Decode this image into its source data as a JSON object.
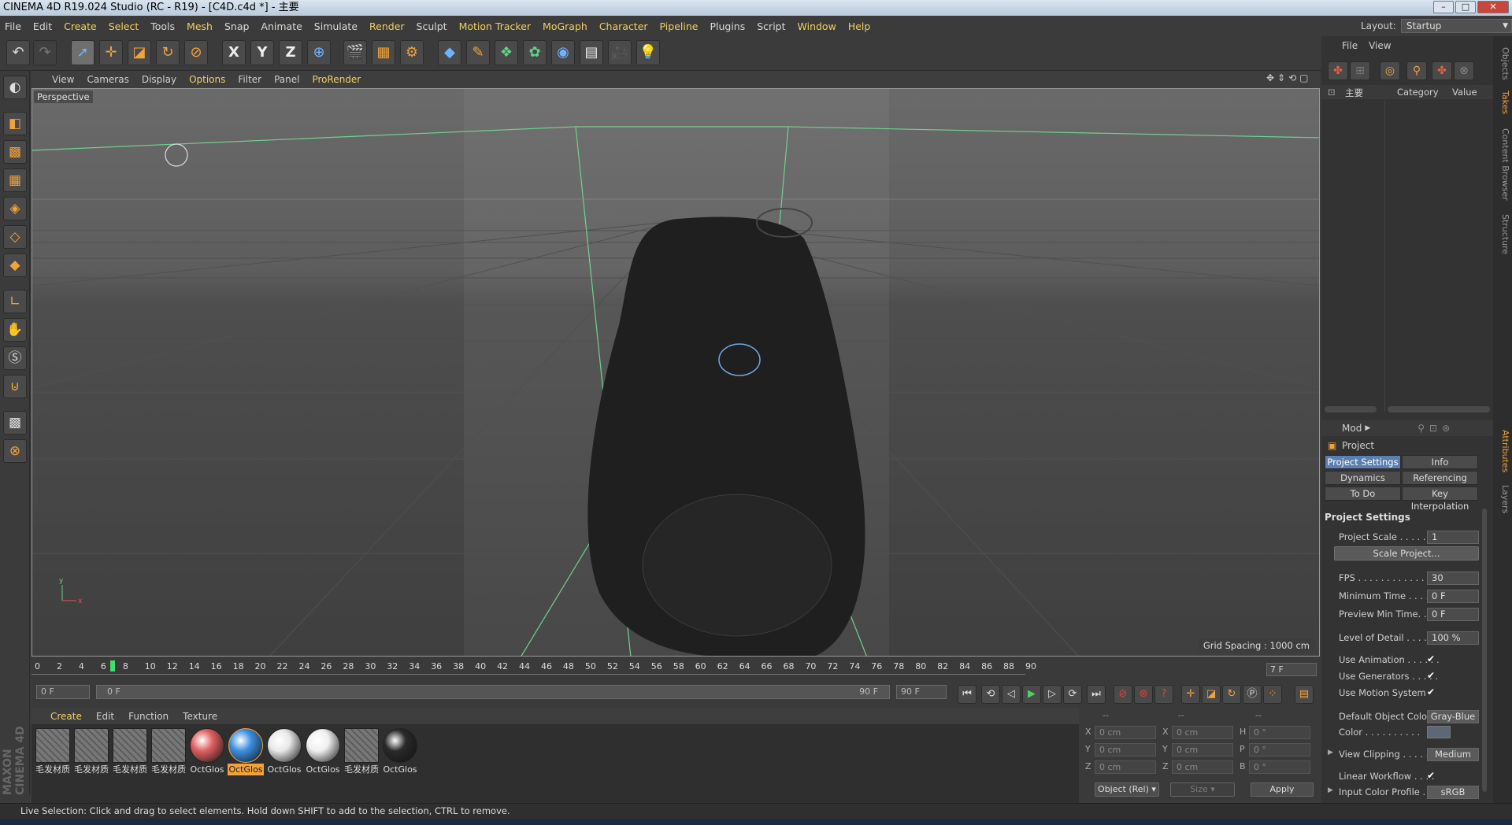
{
  "window": {
    "title": "CINEMA 4D R19.024 Studio (RC - R19) - [C4D.c4d *] - 主要",
    "min": "–",
    "max": "□",
    "close": "✕"
  },
  "menubar": [
    "File",
    "Edit",
    "Create",
    "Select",
    "Tools",
    "Mesh",
    "Snap",
    "Animate",
    "Simulate",
    "Render",
    "Sculpt",
    "Motion Tracker",
    "MoGraph",
    "Character",
    "Pipeline",
    "Plugins",
    "Script",
    "Window",
    "Help"
  ],
  "layout": {
    "label": "Layout:",
    "value": "Startup"
  },
  "toolbar": {
    "undo_icon": "↶",
    "x_axis": "X",
    "y_axis": "Y",
    "z_axis": "Z"
  },
  "viewport": {
    "menu": [
      "View",
      "Cameras",
      "Display",
      "Options",
      "Filter",
      "Panel",
      "ProRender"
    ],
    "label": "Perspective",
    "grid_spacing": "Grid Spacing : 1000 cm",
    "axis_y": "y",
    "axis_x": "x"
  },
  "timeline": {
    "ticks": [
      "0",
      "2",
      "4",
      "6",
      "8",
      "10",
      "12",
      "14",
      "16",
      "18",
      "20",
      "22",
      "24",
      "26",
      "28",
      "30",
      "32",
      "34",
      "36",
      "38",
      "40",
      "42",
      "44",
      "46",
      "48",
      "50",
      "52",
      "54",
      "56",
      "58",
      "60",
      "62",
      "64",
      "66",
      "68",
      "70",
      "72",
      "74",
      "76",
      "78",
      "80",
      "82",
      "84",
      "86",
      "88",
      "90"
    ],
    "current_marker": "7",
    "current_frame": "7 F",
    "start_field": "0 F",
    "range_start": "0 F",
    "range_end": "90 F",
    "end_field": "90 F"
  },
  "materials": {
    "menu": [
      "Create",
      "Edit",
      "Function",
      "Texture"
    ],
    "items": [
      {
        "name": "毛发材质",
        "kind": "hair",
        "color": "#777777"
      },
      {
        "name": "毛发材质",
        "kind": "hair",
        "color": "#777777"
      },
      {
        "name": "毛发材质",
        "kind": "hair",
        "color": "#777777"
      },
      {
        "name": "毛发材质",
        "kind": "hair",
        "color": "#777777"
      },
      {
        "name": "OctGlos",
        "kind": "sphere",
        "color": "#e06060"
      },
      {
        "name": "OctGlos",
        "kind": "sphere",
        "color": "#3c8fe0",
        "selected": true
      },
      {
        "name": "OctGlos",
        "kind": "sphere",
        "color": "#e8e8e8"
      },
      {
        "name": "OctGlos",
        "kind": "sphere",
        "color": "#f0f0f0"
      },
      {
        "name": "毛发材质",
        "kind": "hair",
        "color": "#777777"
      },
      {
        "name": "OctGlos",
        "kind": "sphere",
        "color": "#2a2a2a"
      }
    ]
  },
  "coordinates": {
    "headers": [
      "--",
      "--",
      "--"
    ],
    "rows": [
      {
        "l1": "X",
        "v1": "0 cm",
        "l2": "X",
        "v2": "0 cm",
        "l3": "H",
        "v3": "0 °"
      },
      {
        "l1": "Y",
        "v1": "0 cm",
        "l2": "Y",
        "v2": "0 cm",
        "l3": "P",
        "v3": "0 °"
      },
      {
        "l1": "Z",
        "v1": "0 cm",
        "l2": "Z",
        "v2": "0 cm",
        "l3": "B",
        "v3": "0 °"
      }
    ],
    "mode": "Object (Rel)",
    "size": "Size",
    "apply": "Apply"
  },
  "status": "Live Selection: Click and drag to select elements. Hold down SHIFT to add to the selection, CTRL to remove.",
  "objects": {
    "menu": [
      "File",
      "View"
    ],
    "root": "主要",
    "col_category": "Category",
    "col_value": "Value"
  },
  "attributes": {
    "menu": "Mod",
    "object": "Project",
    "tabs": [
      "Project Settings",
      "Info",
      "Dynamics",
      "Referencing",
      "To Do",
      "Key Interpolation"
    ],
    "section": "Project Settings",
    "scale_label": "Project Scale . . . . . . .",
    "scale_value": "1",
    "scale_button": "Scale Project...",
    "fps_label": "FPS . . . . . . . . . . . . . .",
    "fps_value": "30",
    "min_time_label": "Minimum Time . . . . .",
    "min_time_value": "0 F",
    "prev_min_label": "Preview Min Time. . . .",
    "prev_min_value": "0 F",
    "lod_label": "Level of Detail . . . . . .",
    "lod_value": "100 %",
    "use_anim_label": "Use Animation . . . . . .",
    "use_gen_label": "Use Generators . . . . .",
    "use_motion_label": "Use Motion System",
    "check": "✔",
    "default_color_label": "Default Object Color",
    "default_color_value": "Gray-Blue",
    "color_label": "Color . . . . . . . . . .",
    "clipping_label": "View Clipping . . . . . .",
    "clipping_value": "Medium",
    "linear_label": "Linear Workflow . . . .",
    "input_profile_label": "Input Color Profile . . .",
    "input_profile_value": "sRGB"
  },
  "side_tabs": [
    "Objects",
    "Takes",
    "Content Browser",
    "Structure",
    "Attributes",
    "Layers"
  ],
  "brand": "MAXON CINEMA 4D"
}
